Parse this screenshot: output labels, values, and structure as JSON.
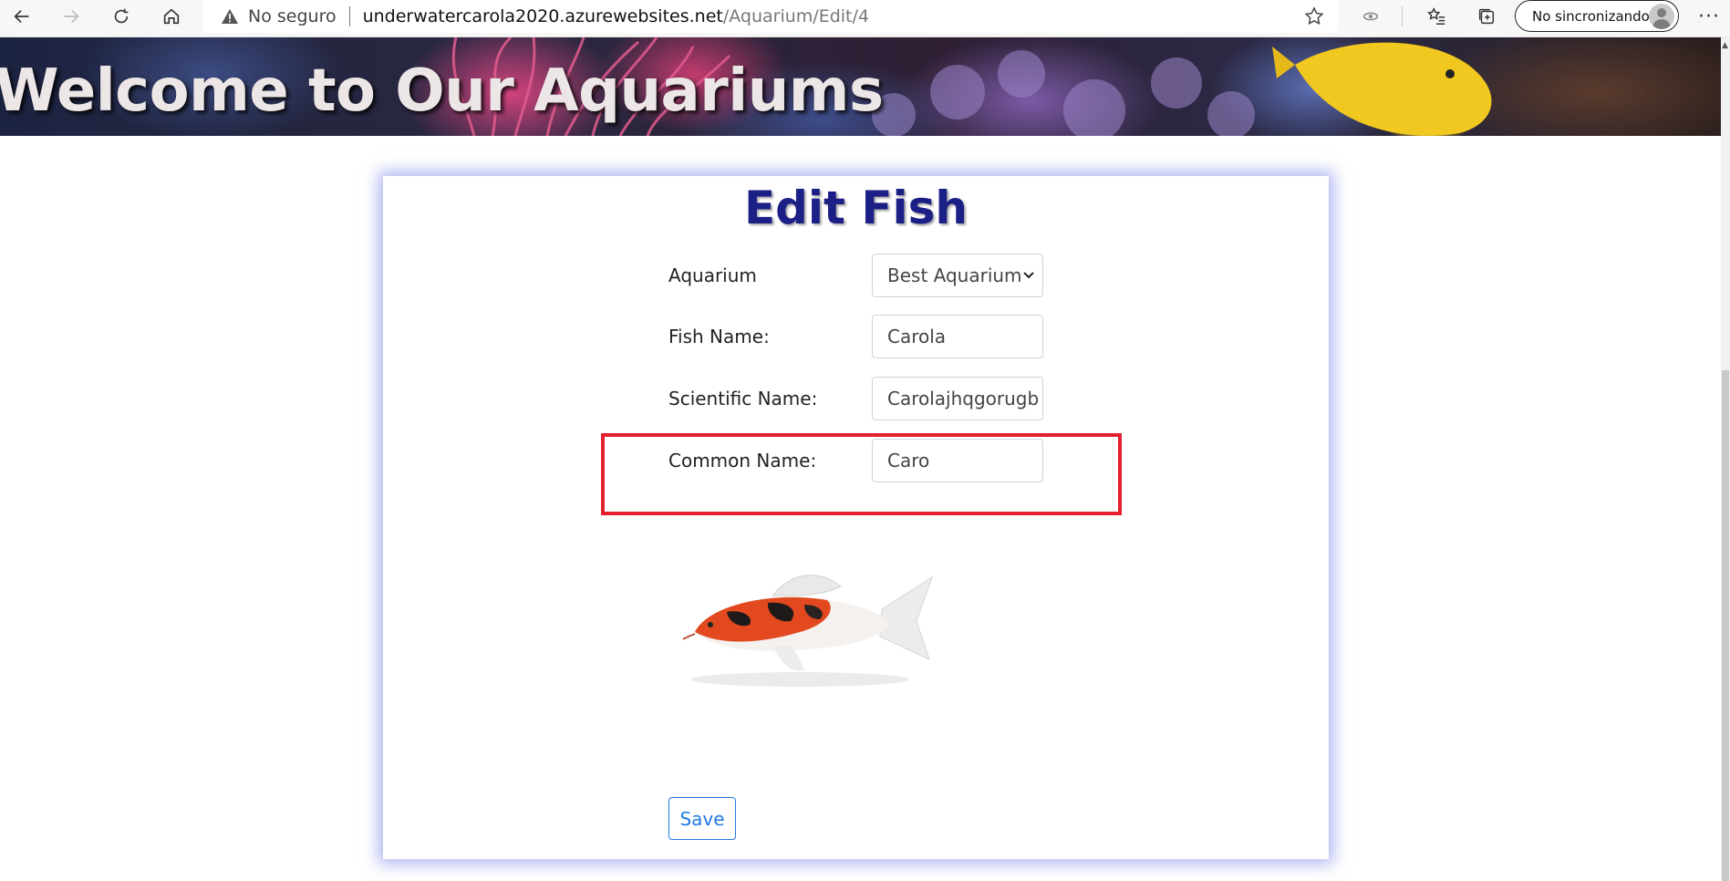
{
  "browser": {
    "security_label": "No seguro",
    "url_host": "underwatercarola2020.azurewebsites.net",
    "url_path": "/Aquarium/Edit/4",
    "sync_label": "No sincronizando",
    "more_label": "···"
  },
  "banner": {
    "title": "Welcome to Our Aquariums"
  },
  "form": {
    "heading": "Edit Fish",
    "aquarium": {
      "label": "Aquarium",
      "selected": "Best Aquarium"
    },
    "fish_name": {
      "label": "Fish Name:",
      "value": "Carola"
    },
    "scientific_name": {
      "label": "Scientific Name:",
      "value": "Carolajhqgorugb"
    },
    "common_name": {
      "label": "Common Name:",
      "value": "Caro"
    },
    "save_label": "Save"
  },
  "colors": {
    "heading": "#1c1f86",
    "highlight": "#e4202f",
    "save_button": "#1f7ae0"
  }
}
